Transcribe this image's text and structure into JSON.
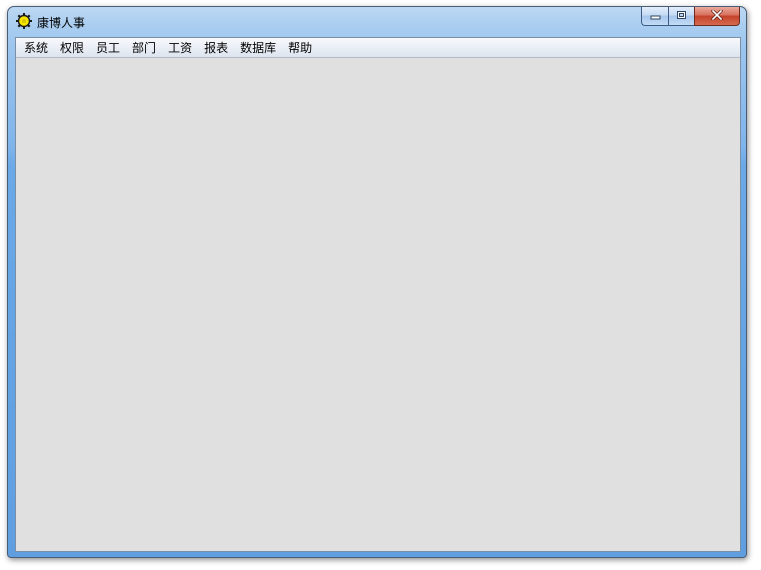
{
  "window": {
    "title": "康博人事",
    "icon": "gear-icon"
  },
  "caption_buttons": {
    "minimize": "minimize-icon",
    "maximize": "maximize-icon",
    "close": "close-icon"
  },
  "menubar": {
    "items": [
      "系统",
      "权限",
      "员工",
      "部门",
      "工资",
      "报表",
      "数据库",
      "帮助"
    ]
  },
  "colors": {
    "titlebar": "#9cc5ee",
    "workspace": "#e0e0e0",
    "close": "#c4412a"
  }
}
